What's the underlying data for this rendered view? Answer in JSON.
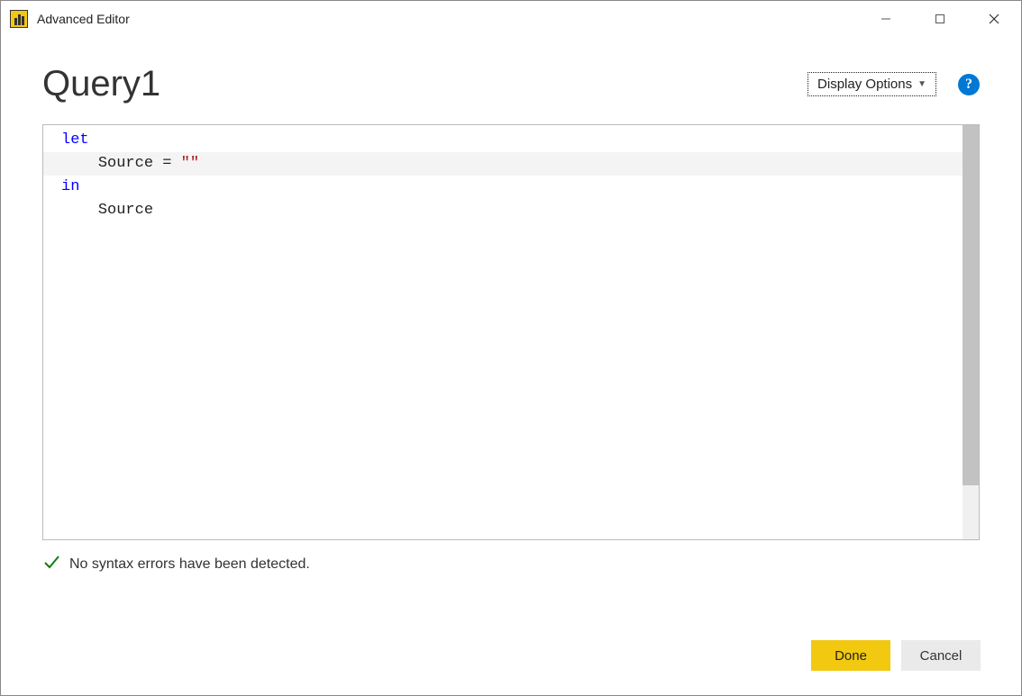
{
  "window": {
    "title": "Advanced Editor"
  },
  "header": {
    "query_name": "Query1",
    "display_options_label": "Display Options",
    "help_symbol": "?"
  },
  "code": {
    "line1_kw": "let",
    "line2_indent": "    ",
    "line2_text": "Source = ",
    "line2_str": "\"\"",
    "line3_kw": "in",
    "line4_indent": "    ",
    "line4_text": "Source"
  },
  "status": {
    "message": "No syntax errors have been detected."
  },
  "buttons": {
    "done": "Done",
    "cancel": "Cancel"
  }
}
